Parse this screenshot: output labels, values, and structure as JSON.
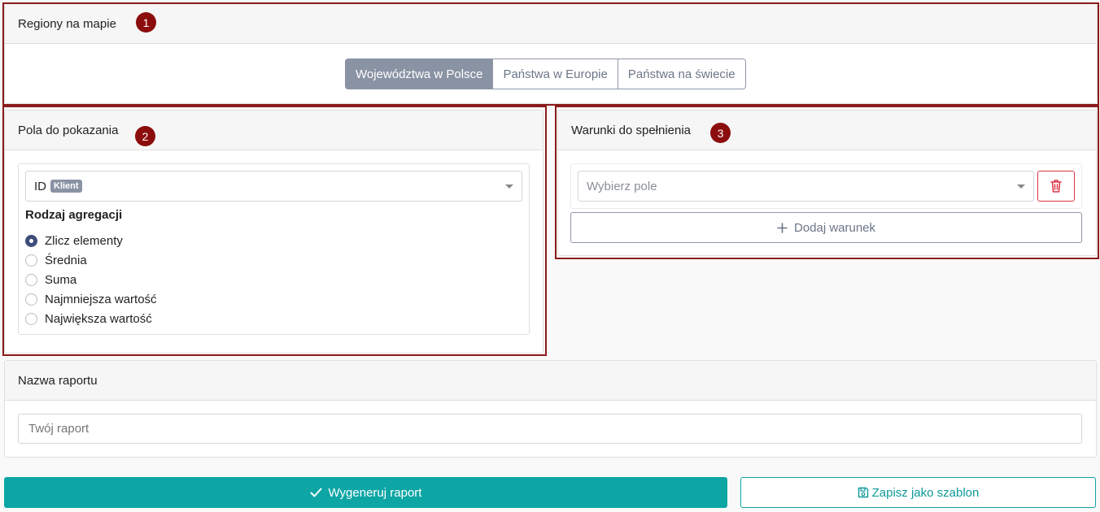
{
  "regions": {
    "title": "Regiony na mapie",
    "step": "1",
    "options": [
      "Województwa w Polsce",
      "Państwa w Europie",
      "Państwa na świecie"
    ],
    "selected": "Województwa w Polsce"
  },
  "fields": {
    "title": "Pola do pokazania",
    "step": "2",
    "field_value": "ID",
    "field_badge": "Klient",
    "aggregation_label": "Rodzaj agregacji",
    "aggregations": [
      "Zlicz elementy",
      "Średnia",
      "Suma",
      "Najmniejsza wartość",
      "Największa wartość"
    ],
    "selected_aggregation": "Zlicz elementy"
  },
  "conditions": {
    "title": "Warunki do spełnienia",
    "step": "3",
    "field_placeholder": "Wybierz pole",
    "add_label": "Dodaj warunek",
    "add_icon": "plus-icon",
    "delete_icon": "trash-icon"
  },
  "report": {
    "title": "Nazwa raportu",
    "name_placeholder": "Twój raport"
  },
  "actions": {
    "generate_label": "Wygeneruj raport",
    "generate_icon": "check-icon",
    "save_label": "Zapisz jako szablon",
    "save_icon": "floppy-disk-icon"
  },
  "colors": {
    "accent": "#0ea5a5",
    "segment_active": "#8a93a4",
    "step_badge": "#8b0d0d",
    "danger": "#dc3545"
  }
}
